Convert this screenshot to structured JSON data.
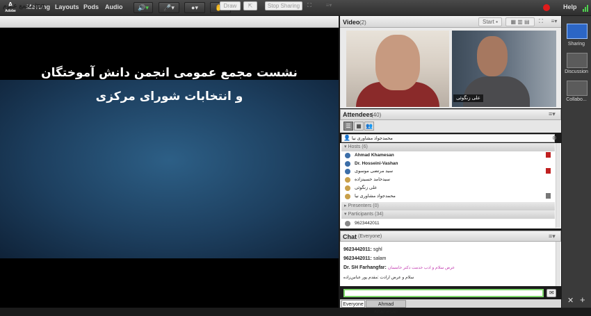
{
  "menu": {
    "logo_text": "Adobe",
    "items": [
      "Meeting",
      "Layouts",
      "Pods",
      "Audio"
    ],
    "help": "Help"
  },
  "share": {
    "file_name": "مجمع عموم.jpg",
    "draw_label": "Draw",
    "stop_sharing_label": "Stop Sharing",
    "slide_line1": "نشست مجمع عمومی انجمن دانش آموختگان",
    "slide_line2": "و انتخابات شورای مرکزی"
  },
  "video": {
    "title": "Video",
    "count": "(2)",
    "start_label": "Start",
    "cam2_name": "علی زنگوئی"
  },
  "attendees": {
    "title": "Attendees",
    "count": "(40)",
    "search_value": "محمدجواد مشاوری نیا",
    "hosts_label": "Hosts (6)",
    "hosts": [
      {
        "name": "Ahmad Khamesan",
        "flag": true
      },
      {
        "name": "Dr. Hosseini-Vashan",
        "flag": false
      },
      {
        "name": "سید مرتضی موسوی",
        "flag": true
      },
      {
        "name": "سیدحامد حسینزاده",
        "flag": false
      },
      {
        "name": "علی زنگوئی",
        "flag": false
      },
      {
        "name": "محمدجواد مشاوری نیا",
        "flag": false
      }
    ],
    "presenters_label": "Presenters (0)",
    "participants_label": "Participants (34)",
    "participants": [
      "9623442011"
    ]
  },
  "chat": {
    "title": "Chat",
    "scope": "(Everyone)",
    "messages": [
      {
        "sender": "9623442011:",
        "text": "sghl",
        "color": "#222222"
      },
      {
        "sender": "9623442011:",
        "text": "salam",
        "color": "#222222"
      },
      {
        "sender": "Dr. SH Farhangfar:",
        "text": "عرض سلام و ادب خدمت دکتر خامسان",
        "color": "#c23ab0"
      },
      {
        "sender": "",
        "text": "سلام و عرض ارادت :مقدم پور عباس‌زاده",
        "color": "#222222"
      }
    ],
    "tabs": [
      "Everyone",
      "Ahmad Khamesan"
    ]
  },
  "layouts": {
    "items": [
      "Sharing",
      "Discussion",
      "Collabo..."
    ]
  },
  "colors": {
    "accent": "#3c6ea8",
    "record": "#e01b1b",
    "chat_input_border": "#7fd86c"
  }
}
